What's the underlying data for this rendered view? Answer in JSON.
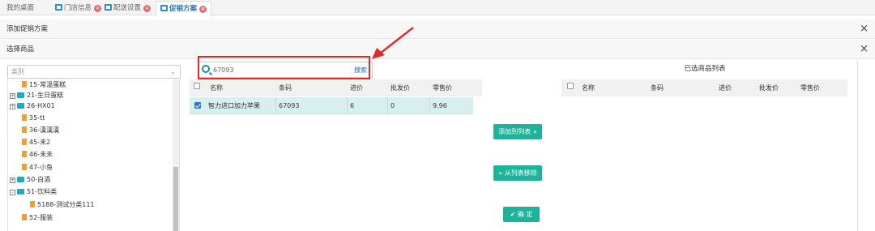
{
  "tabs": [
    {
      "label": "我的桌面",
      "icon": "none",
      "closable": false
    },
    {
      "label": "门店信息",
      "icon": "tab-icon",
      "closable": true
    },
    {
      "label": "配送设置",
      "icon": "tab-icon",
      "closable": true
    },
    {
      "label": "促销方案",
      "icon": "tab-icon",
      "closable": true,
      "active": true
    }
  ],
  "close_glyph": "×",
  "panels": {
    "add_promo": {
      "title": "添加促销方案"
    },
    "select_goods": {
      "title": "选择商品"
    }
  },
  "category": {
    "placeholder": "类别",
    "tree": [
      {
        "label": "15-常温蛋糕",
        "kind": "leaf"
      },
      {
        "label": "21-生日蛋糕",
        "kind": "folder",
        "expander": "+"
      },
      {
        "label": "26-HX01",
        "kind": "folder",
        "expander": "+"
      },
      {
        "label": "35-tt",
        "kind": "leaf"
      },
      {
        "label": "36-漢漢漢",
        "kind": "leaf"
      },
      {
        "label": "45-未2",
        "kind": "leaf"
      },
      {
        "label": "46-未未",
        "kind": "leaf"
      },
      {
        "label": "47-小鱼",
        "kind": "leaf"
      },
      {
        "label": "50-白酒",
        "kind": "folder",
        "expander": "+"
      },
      {
        "label": "51-饮料类",
        "kind": "folder",
        "expander": "-"
      },
      {
        "label": "5188-测试分类111",
        "kind": "leaf",
        "child": true
      },
      {
        "label": "52-服装",
        "kind": "leaf"
      }
    ]
  },
  "search": {
    "value": "67093",
    "button": "搜索"
  },
  "left_table": {
    "headers": [
      "名称",
      "条码",
      "进价",
      "批发价",
      "零售价"
    ],
    "rows": [
      {
        "checked": true,
        "cells": [
          "智力进口加力苹果",
          "67093",
          "6",
          "0",
          "9.96"
        ]
      }
    ]
  },
  "buttons": {
    "add": "添加到列表 »",
    "remove": "« 从列表移除",
    "confirm": "✔ 确 定"
  },
  "right_table": {
    "title": "已选商品列表",
    "headers": [
      "名称",
      "条码",
      "进价",
      "批发价",
      "零售价"
    ],
    "rows": []
  },
  "colors": {
    "accent": "#1cb39b",
    "selected_row": "#d8eff0",
    "highlight": "#e02b2b",
    "link": "#1b73c4"
  }
}
